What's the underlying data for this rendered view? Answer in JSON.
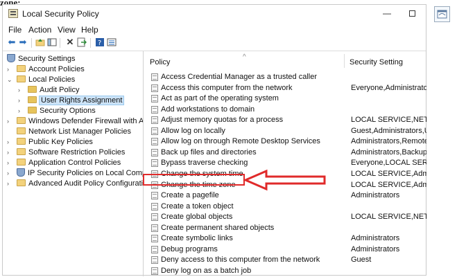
{
  "caption_fragment": "zone:",
  "window": {
    "title": "Local Security Policy",
    "minimize_glyph": "—"
  },
  "menu": [
    "File",
    "Action",
    "View",
    "Help"
  ],
  "toolbar_icons": [
    "back-arrow-icon",
    "forward-arrow-icon",
    "up-folder-icon",
    "show-hide-tree-icon",
    "delete-icon",
    "export-list-icon",
    "help-icon",
    "properties-icon"
  ],
  "tree": {
    "root": "Security Settings",
    "account_policies": "Account Policies",
    "local_policies": "Local Policies",
    "audit_policy": "Audit Policy",
    "user_rights_assignment": "User Rights Assignment",
    "security_options": "Security Options",
    "windows_defender_firewall": "Windows Defender Firewall with Adva",
    "network_list_manager": "Network List Manager Policies",
    "public_key_policies": "Public Key Policies",
    "software_restriction": "Software Restriction Policies",
    "application_control": "Application Control Policies",
    "ip_security": "IP Security Policies on Local Compute",
    "advanced_audit": "Advanced Audit Policy Configuration"
  },
  "columns": {
    "policy": "Policy",
    "security_setting": "Security Setting"
  },
  "rows": [
    {
      "policy": "Access Credential Manager as a trusted caller",
      "setting": ""
    },
    {
      "policy": "Access this computer from the network",
      "setting": "Everyone,Administrators..."
    },
    {
      "policy": "Act as part of the operating system",
      "setting": ""
    },
    {
      "policy": "Add workstations to domain",
      "setting": ""
    },
    {
      "policy": "Adjust memory quotas for a process",
      "setting": "LOCAL SERVICE,NETWO..."
    },
    {
      "policy": "Allow log on locally",
      "setting": "Guest,Administrators,Us..."
    },
    {
      "policy": "Allow log on through Remote Desktop Services",
      "setting": "Administrators,Remote ..."
    },
    {
      "policy": "Back up files and directories",
      "setting": "Administrators,Backup ..."
    },
    {
      "policy": "Bypass traverse checking",
      "setting": "Everyone,LOCAL SERVIC..."
    },
    {
      "policy": "Change the system time",
      "setting": "LOCAL SERVICE,Admini..."
    },
    {
      "policy": "Change the time zone",
      "setting": "LOCAL SERVICE,Admini..."
    },
    {
      "policy": "Create a pagefile",
      "setting": "Administrators"
    },
    {
      "policy": "Create a token object",
      "setting": ""
    },
    {
      "policy": "Create global objects",
      "setting": "LOCAL SERVICE,NETWO..."
    },
    {
      "policy": "Create permanent shared objects",
      "setting": ""
    },
    {
      "policy": "Create symbolic links",
      "setting": "Administrators"
    },
    {
      "policy": "Debug programs",
      "setting": "Administrators"
    },
    {
      "policy": "Deny access to this computer from the network",
      "setting": "Guest"
    },
    {
      "policy": "Deny log on as a batch job",
      "setting": ""
    }
  ],
  "annotation": {
    "highlight_color": "#e02a2a"
  }
}
